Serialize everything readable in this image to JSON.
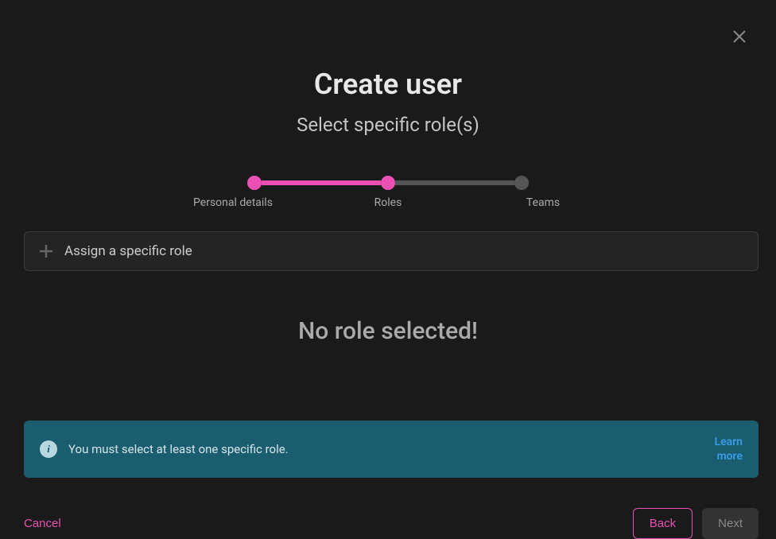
{
  "modal": {
    "title": "Create user",
    "subtitle": "Select specific role(s)"
  },
  "stepper": {
    "steps": [
      {
        "label": "Personal details",
        "active": true
      },
      {
        "label": "Roles",
        "active": true
      },
      {
        "label": "Teams",
        "active": false
      }
    ]
  },
  "assign": {
    "placeholder": "Assign a specific role"
  },
  "empty_state": "No role selected!",
  "info": {
    "message": "You must select at least one specific role.",
    "link_label": "Learn more"
  },
  "buttons": {
    "cancel": "Cancel",
    "back": "Back",
    "next": "Next"
  }
}
